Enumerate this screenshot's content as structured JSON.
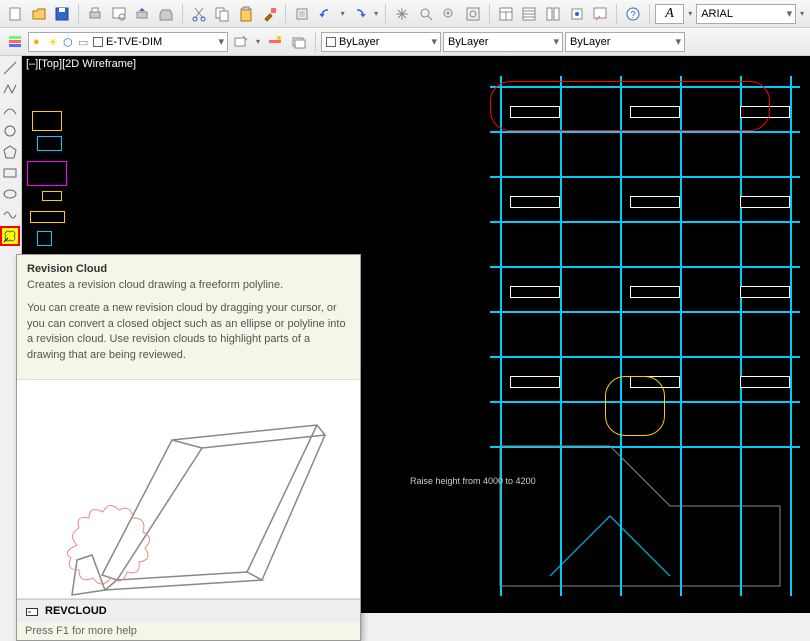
{
  "toolbar1": {
    "font_label": "A",
    "font_name": "ARIAL"
  },
  "toolbar2": {
    "layer_name": "E-TVE-DIM",
    "prop1": "ByLayer",
    "prop2": "ByLayer",
    "prop3": "ByLayer"
  },
  "viewport": {
    "label": "[–][Top][2D Wireframe]"
  },
  "annotation": {
    "raise_height": "Raise height from 4000 to 4200"
  },
  "tooltip": {
    "title": "Revision Cloud",
    "summary": "Creates a revision cloud drawing a freeform polyline.",
    "detail": "You can create a new revision cloud by dragging your cursor, or you can convert a closed object such as an ellipse or polyline into a revision cloud. Use revision clouds to highlight parts of a drawing that are being reviewed.",
    "command": "REVCLOUD",
    "help": "Press F1 for more help"
  }
}
